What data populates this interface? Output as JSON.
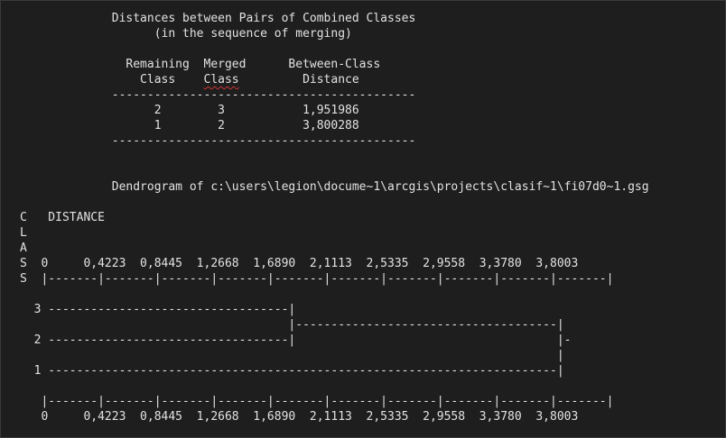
{
  "output": {
    "lines": [
      "             Distances between Pairs of Combined Classes",
      "                   (in the sequence of merging)",
      "",
      "               Remaining  Merged      Between-Class",
      "                 Class    Class         Distance",
      "             -------------------------------------------",
      "                   2        3           1,951986",
      "                   1        2           3,800288",
      "             -------------------------------------------",
      "",
      "",
      "             Dendrogram of c:\\users\\legion\\docume~1\\arcgis\\projects\\clasif~1\\fi07d0~1.gsg",
      "",
      "C   DISTANCE",
      "L",
      "A",
      "S  0     0,4223  0,8445  1,2668  1,6890  2,1113  2,5335  2,9558  3,3780  3,8003",
      "S  |-------|-------|-------|-------|-------|-------|-------|-------|-------|-------|",
      "",
      "  3 ----------------------------------|",
      "                                      |-------------------------------------|",
      "  2 ----------------------------------|                                     |-",
      "                                                                            |",
      "  1 ------------------------------------------------------------------------|",
      "",
      "   |-------|-------|-------|-------|-------|-------|-------|-------|-------|-------|",
      "   0     0,4223  0,8445  1,2668  1,6890  2,1113  2,5335  2,9558  3,3780  3,8003"
    ]
  }
}
